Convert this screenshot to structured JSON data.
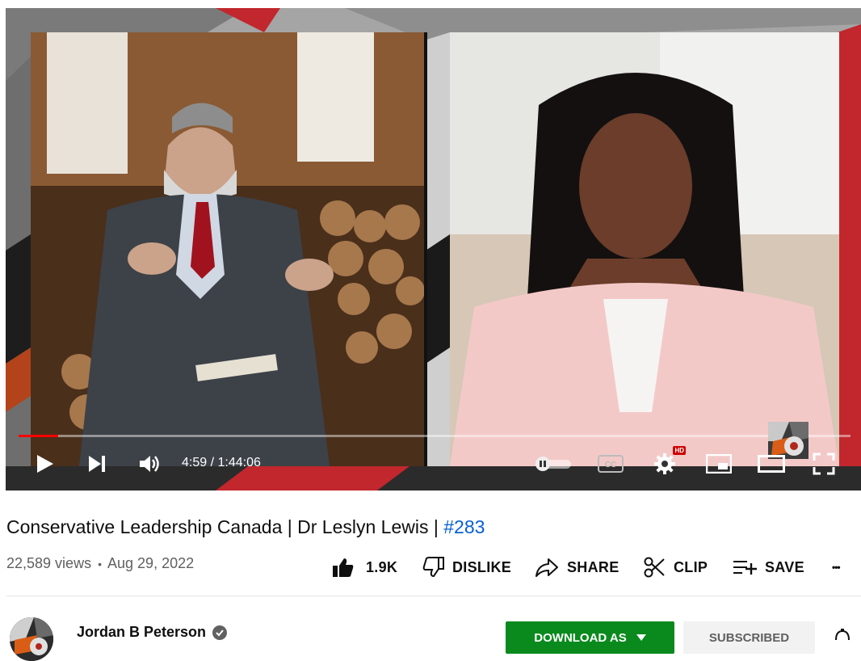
{
  "player": {
    "current_time": "4:59",
    "separator": " / ",
    "duration": "1:44:06",
    "progress_fraction": 0.048,
    "autoplay": "off",
    "hd_badge": "HD",
    "controls": [
      "play-icon",
      "next-icon",
      "volume-icon",
      "autoplay-toggle",
      "captions-icon",
      "settings-icon",
      "miniplayer-icon",
      "theater-icon",
      "fullscreen-icon"
    ]
  },
  "video": {
    "title": "Conservative Leadership Canada | Dr Leslyn Lewis | ",
    "hashtag": "#283",
    "views": "22,589 views",
    "dot": "•",
    "date": "Aug 29, 2022"
  },
  "actions": {
    "like_count": "1.9K",
    "dislike_label": "DISLIKE",
    "share_label": "SHARE",
    "clip_label": "CLIP",
    "save_label": "SAVE",
    "more_label": "•••"
  },
  "channel": {
    "name": "Jordan B Peterson",
    "download_label": "DOWNLOAD AS",
    "subscribed_label": "SUBSCRIBED"
  },
  "colors": {
    "accent_red": "#ff0000",
    "link_blue": "#065fd4",
    "download_green": "#0a8a1d"
  }
}
